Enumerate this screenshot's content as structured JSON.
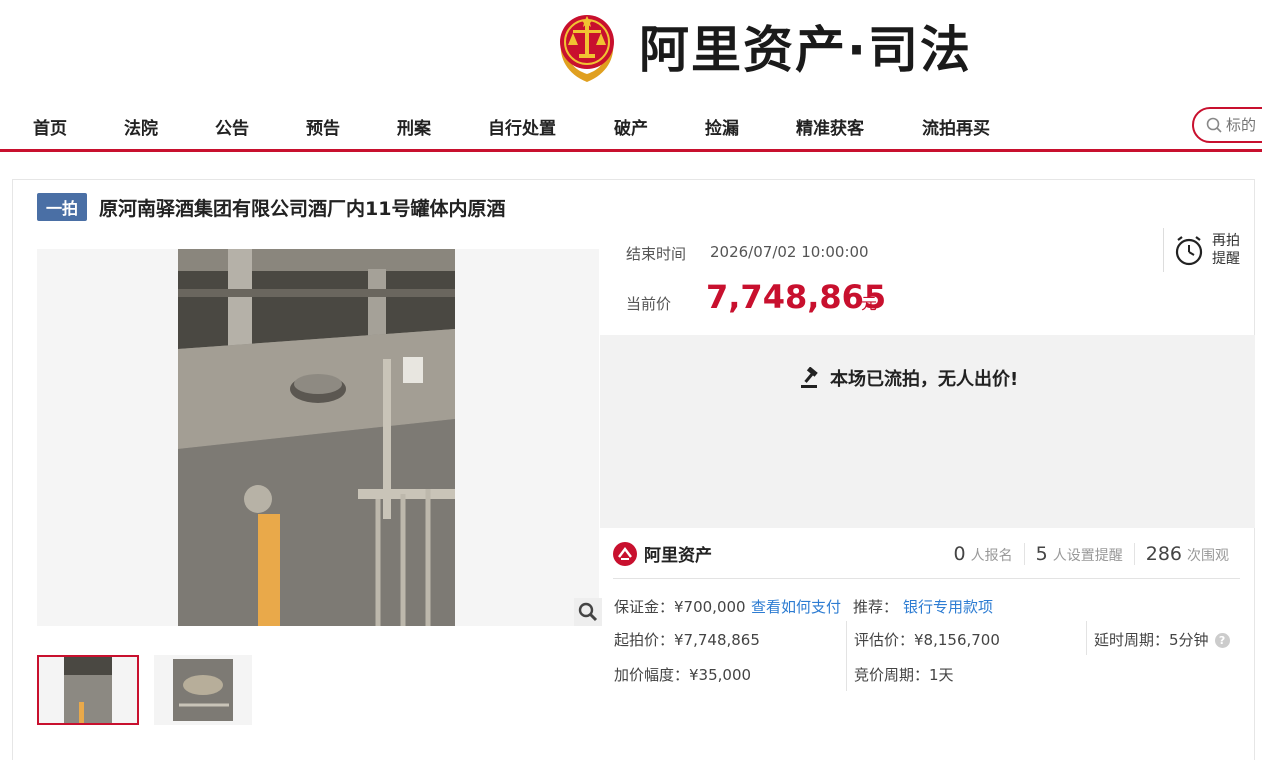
{
  "header": {
    "brand": "阿里资产·司法"
  },
  "nav": {
    "items": [
      "首页",
      "法院",
      "公告",
      "预告",
      "刑案",
      "自行处置",
      "破产",
      "捡漏",
      "精准获客",
      "流拍再买"
    ]
  },
  "search": {
    "placeholder": "标的"
  },
  "auction": {
    "tag": "一拍",
    "title": "原河南驿酒集团有限公司酒厂内11号罐体内原酒",
    "end_time_label": "结束时间",
    "end_time": "2026/07/02 10:00:00",
    "current_price_label": "当前价",
    "current_price": "7,748,865",
    "price_unit": "元",
    "remind_label_1": "再拍",
    "remind_label_2": "提醒",
    "status": "本场已流拍，无人出价!",
    "platform": "阿里资产",
    "stats": {
      "signups": "0",
      "signups_label": "人报名",
      "reminders": "5",
      "reminders_label": "人设置提醒",
      "views": "286",
      "views_label": "次围观"
    },
    "deposit": "保证金：¥700,000",
    "how_to_pay": "查看如何支付",
    "recommend_label": "推荐：",
    "recommend_link": "银行专用款项",
    "start_price": "起拍价：¥7,748,865",
    "appraisal_price": "评估价：¥8,156,700",
    "delay_period": "延时周期：5分钟",
    "increment": "加价幅度：¥35,000",
    "bid_period": "竞价周期：1天"
  },
  "colors": {
    "accent": "#c8102e",
    "tag": "#4a6fa5",
    "link": "#2d7cd2"
  }
}
